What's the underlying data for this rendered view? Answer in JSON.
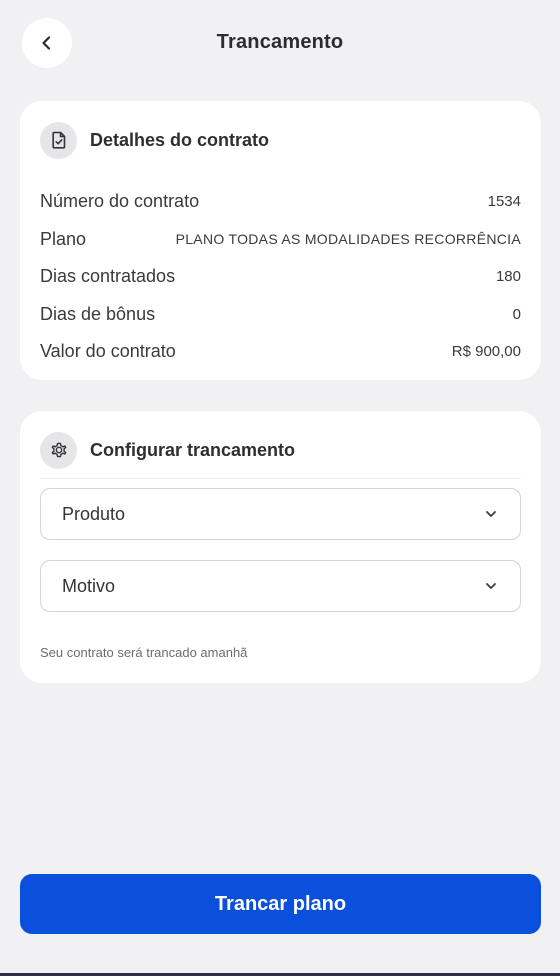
{
  "header": {
    "title": "Trancamento",
    "back_icon": "chevron-left-icon"
  },
  "contract_details": {
    "title": "Detalhes do contrato",
    "icon": "document-check-icon",
    "rows": [
      {
        "label": "Número do contrato",
        "value": "1534"
      },
      {
        "label": "Plano",
        "value": "PLANO TODAS AS MODALIDADES RECORRÊNCIA"
      },
      {
        "label": "Dias contratados",
        "value": "180"
      },
      {
        "label": "Dias de bônus",
        "value": "0"
      },
      {
        "label": "Valor do contrato",
        "value": "R$ 900,00"
      }
    ]
  },
  "lock_config": {
    "title": "Configurar trancamento",
    "icon": "gear-icon",
    "product_select": {
      "label": "Produto"
    },
    "reason_select": {
      "label": "Motivo"
    },
    "hint": "Seu contrato será trancado amanhã"
  },
  "actions": {
    "submit_label": "Trancar plano"
  },
  "colors": {
    "background": "#f1f1f3",
    "card": "#ffffff",
    "primary": "#0a50dc",
    "text": "#2a2a2e"
  }
}
